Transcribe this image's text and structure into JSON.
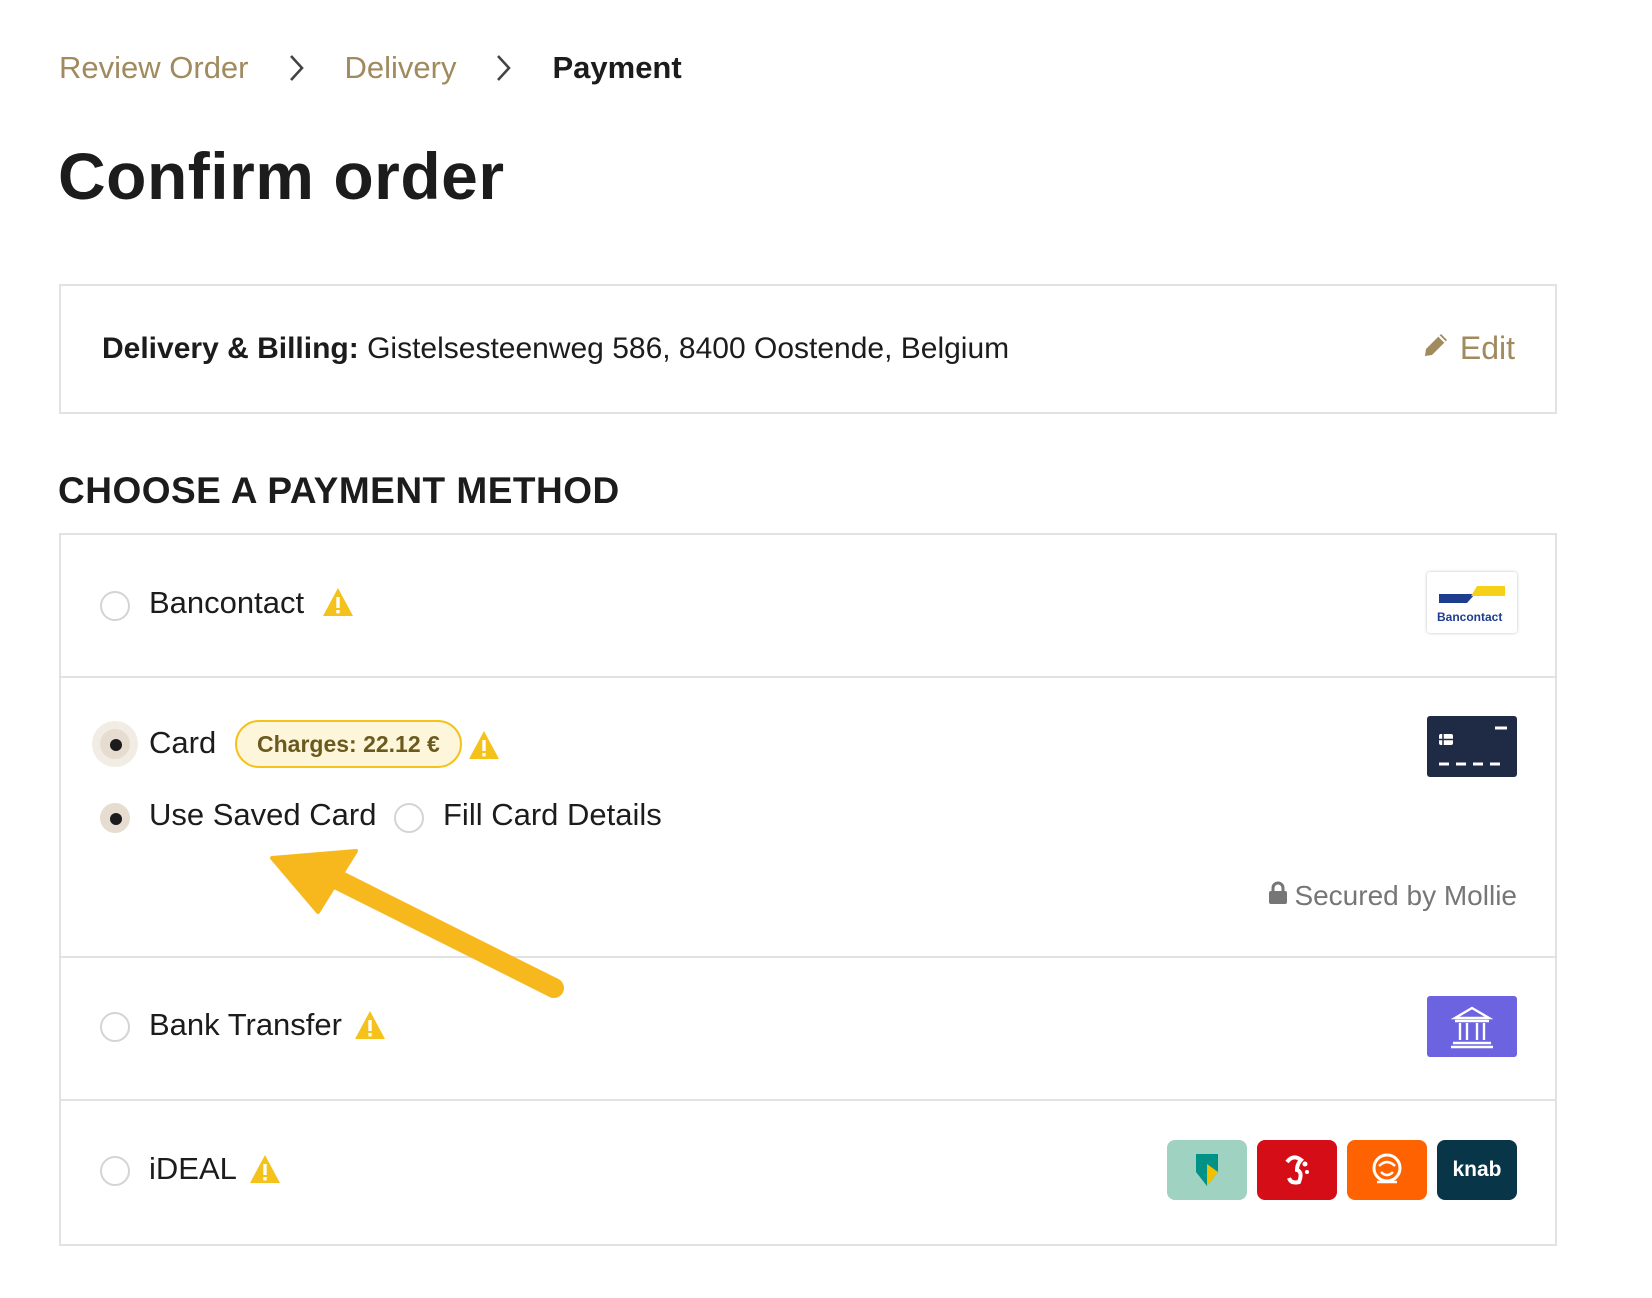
{
  "breadcrumb": {
    "step1": "Review Order",
    "step2": "Delivery",
    "step3": "Payment"
  },
  "page": {
    "title": "Confirm order"
  },
  "address": {
    "label": "Delivery & Billing:",
    "value": "Gistelsesteenweg 586, 8400 Oostende, Belgium",
    "edit_label": "Edit"
  },
  "payment": {
    "heading": "CHOOSE A PAYMENT METHOD",
    "methods": [
      {
        "label": "Bancontact",
        "selected": false,
        "logo": "bancontact-logo",
        "logo_text": "Bancontact"
      },
      {
        "label": "Card",
        "selected": true,
        "charges": "Charges: 22.12 €",
        "logo": "credit-card-logo",
        "options": [
          {
            "label": "Use Saved Card",
            "selected": true
          },
          {
            "label": "Fill Card Details",
            "selected": false
          }
        ],
        "secured_text": "Secured by Mollie"
      },
      {
        "label": "Bank Transfer",
        "selected": false,
        "logo": "bank-building-logo"
      },
      {
        "label": "iDEAL",
        "selected": false,
        "bank_logos": [
          "abn-amro-logo",
          "sns-logo",
          "ing-logo",
          "knab-logo"
        ],
        "knab_text": "knab"
      }
    ]
  },
  "colors": {
    "accent_gold": "#a08a5e",
    "warning_yellow": "#f4c21a",
    "badge_bg": "#fdf6da",
    "bank_purple": "#6c63e0",
    "card_navy": "#1f2a44",
    "arrow": "#f6b81c"
  }
}
